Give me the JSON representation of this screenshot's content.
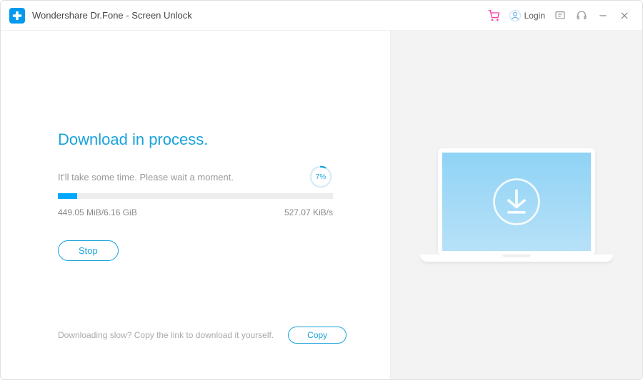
{
  "app": {
    "title": "Wondershare Dr.Fone - Screen Unlock"
  },
  "titlebar": {
    "login": "Login"
  },
  "main": {
    "heading": "Download in process.",
    "subline": "It'll take some time. Please wait a moment.",
    "progress_percent": 7,
    "progress_percent_label": "7%",
    "downloaded": "449.05 MiB/6.16 GiB",
    "speed": "527.07 KiB/s",
    "stop_label": "Stop"
  },
  "footer": {
    "hint": "Downloading slow? Copy the link to download it yourself.",
    "copy_label": "Copy"
  }
}
